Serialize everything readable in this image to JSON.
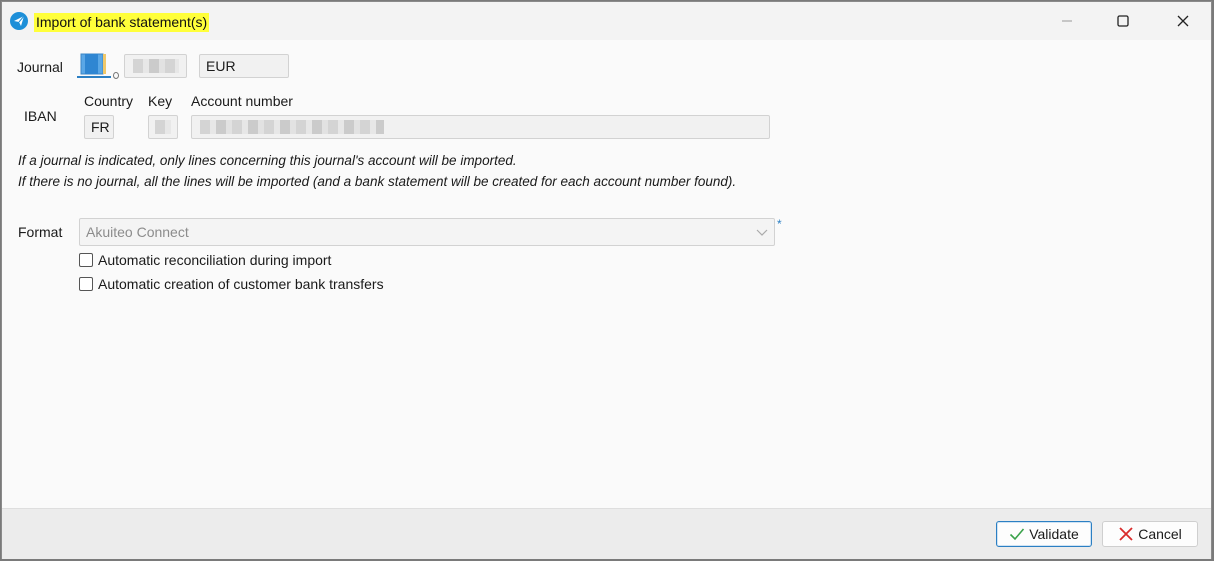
{
  "window": {
    "title": "Import of bank statement(s)",
    "icon": "paper-plane-icon",
    "controls": [
      "minimize-icon",
      "maximize-icon",
      "close-icon"
    ]
  },
  "journal": {
    "label": "Journal",
    "currency": "EUR"
  },
  "iban": {
    "label": "IBAN",
    "country_label": "Country",
    "country_value": "FR",
    "key_label": "Key",
    "account_label": "Account number"
  },
  "notes": {
    "line1": "If a journal is indicated, only lines concerning this journal's account will be imported.",
    "line2": "If there is no journal, all the lines will be imported (and a bank statement will be created for each account number found)."
  },
  "format": {
    "label": "Format",
    "value": "Akuiteo Connect",
    "required_mark": "*"
  },
  "options": [
    {
      "label": "Automatic reconciliation during import",
      "checked": false
    },
    {
      "label": "Automatic creation of customer bank transfers",
      "checked": false
    }
  ],
  "footer": {
    "validate_label": "Validate",
    "cancel_label": "Cancel"
  },
  "colors": {
    "title_highlight": "#ffff3a",
    "accent": "#2b7fc3",
    "validate_check": "#3aa24a",
    "cancel_x": "#d92b2b"
  }
}
